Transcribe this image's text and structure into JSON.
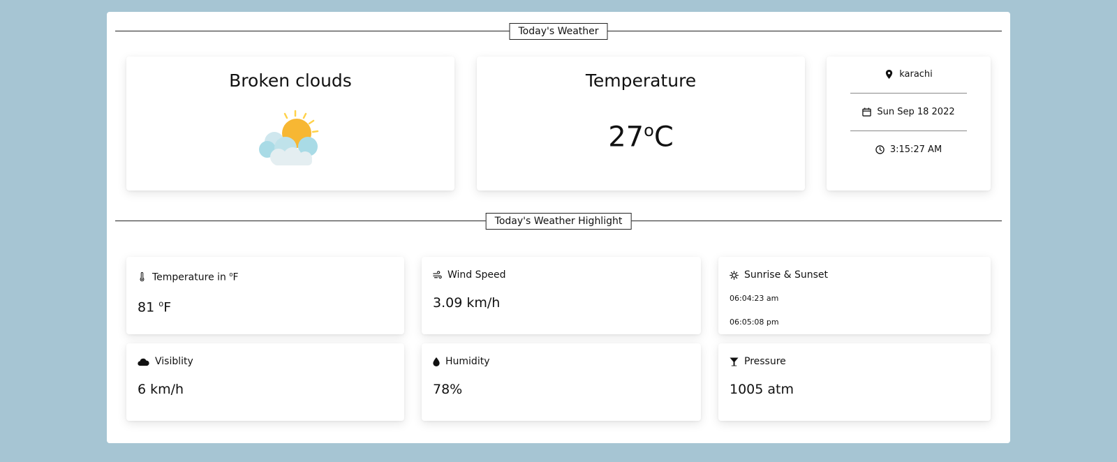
{
  "sections": {
    "today_title": "Today's Weather",
    "highlight_title": "Today's Weather Highlight"
  },
  "condition": {
    "title": "Broken clouds",
    "icon": "sun-behind-clouds-icon"
  },
  "temperature": {
    "title": "Temperature",
    "value": "27",
    "unit_deg": "o",
    "unit": "C"
  },
  "location": {
    "city": "karachi",
    "date": "Sun Sep 18 2022",
    "time": "3:15:27 AM"
  },
  "highlights": {
    "temp_f": {
      "label_prefix": "Temperature in ",
      "label_deg": "o",
      "label_unit": "F",
      "value": "81 ",
      "value_deg": "o",
      "value_unit": "F"
    },
    "wind": {
      "label": "Wind Speed",
      "value": "3.09 km/h"
    },
    "sun": {
      "label": "Sunrise & Sunset",
      "sunrise": "06:04:23 am",
      "sunset": "06:05:08 pm"
    },
    "visibility": {
      "label": "Visiblity",
      "value": "6 km/h"
    },
    "humidity": {
      "label": "Humidity",
      "value": "78%"
    },
    "pressure": {
      "label": "Pressure",
      "value": "1005 atm"
    }
  },
  "colors": {
    "background": "#a6c5d3",
    "sun": "#f7b733",
    "cloud": "#a9dbe6"
  }
}
